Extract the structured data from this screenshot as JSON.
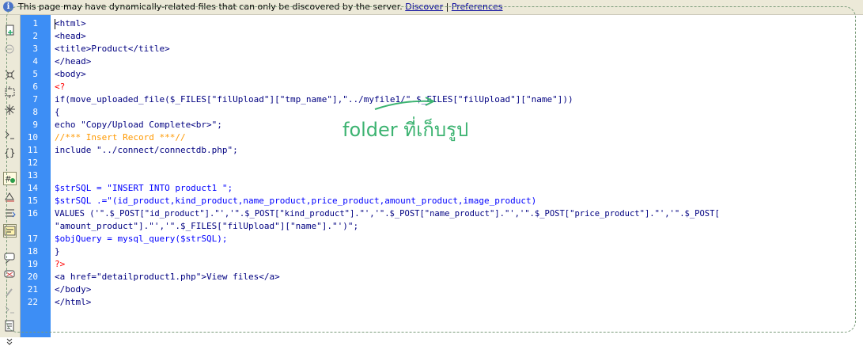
{
  "infobar": {
    "icon": "info-icon",
    "message": "This page may have dynamically-related files that can only be discovered by the server.",
    "discover_label": "Discover",
    "separator": "|",
    "preferences_label": "Preferences"
  },
  "toolbar": {
    "icons": [
      "file-management-icon",
      "preview-icon",
      "collapse-tag-icon",
      "collapse-selection-icon",
      "expand-all-icon",
      "select-parent-tag-icon",
      "balance-braces-icon",
      "line-numbers-icon",
      "highlight-invalid-code-icon",
      "syntax-coloring-icon",
      "word-wrap-icon",
      "apply-comment-icon",
      "remove-comment-icon",
      "wrap-tag-icon",
      "recent-snippets-icon",
      "format-source-icon"
    ]
  },
  "editor": {
    "line_numbers": [
      "1",
      "2",
      "3",
      "4",
      "5",
      "6",
      "7",
      "8",
      "9",
      "10",
      "11",
      "12",
      "13",
      "14",
      "15",
      "16",
      "17",
      "18",
      "19",
      "20",
      "21",
      "22"
    ],
    "lines": [
      "<html>",
      "<head>",
      "<title>Product</title>",
      "</head>",
      "<body>",
      "<?",
      "if(move_uploaded_file($_FILES[\"filUpload\"][\"tmp_name\"],\"../myfile1/\".$_FILES[\"filUpload\"][\"name\"]))",
      "{",
      "echo \"Copy/Upload Complete<br>\";",
      "//*** Insert Record ***//",
      "include \"../connect/connectdb.php\";",
      "",
      "",
      "$strSQL = \"INSERT INTO product1 \";",
      "$strSQL .=\"(id_product,kind_product,name_product,price_product,amount_product,image_product)",
      "VALUES ('\".$_POST[\"id_product\"].\"','\".$_POST[\"kind_product\"].\"','\".$_POST[\"name_product\"].\"','\".$_POST[\"price_product\"].\"','\".$_POST[",
      "\"amount_product\"].\"','\".$_FILES[\"filUpload\"][\"name\"].\"')\";",
      "$objQuery = mysql_query($strSQL);",
      "}",
      "?>",
      "<a href=\"detailproduct1.php\">View files</a>",
      "</body>",
      "</html>"
    ],
    "annotation": "folder ที่เก็บรูป"
  },
  "colors": {
    "gutter": "#3d8ef5",
    "annotation": "#3cb371",
    "php_delim": "#ff0000",
    "variable": "#0000ff",
    "comment": "#ff9900",
    "markup": "#000080"
  }
}
